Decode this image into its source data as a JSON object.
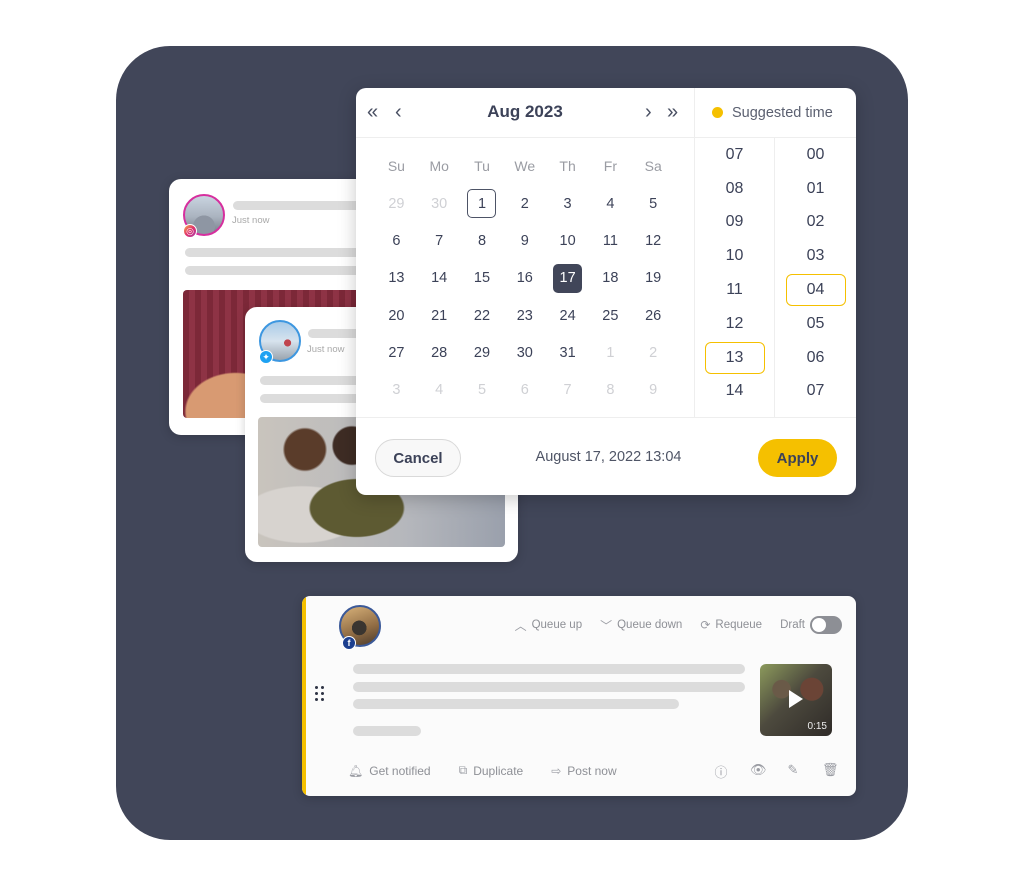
{
  "colors": {
    "backdrop": "#414659",
    "accent": "#f5c000",
    "selected_day": "#414659",
    "instagram": "#d62f9e",
    "twitter": "#1da1f2",
    "facebook": "#1c3f8f"
  },
  "posts": [
    {
      "network": "instagram",
      "timestamp": "Just now"
    },
    {
      "network": "twitter",
      "timestamp": "Just now"
    }
  ],
  "picker": {
    "nav": {
      "prev_year": "«",
      "prev_month": "‹",
      "next_month": "›",
      "next_year": "»"
    },
    "month_title": "Aug 2023",
    "suggested_label": "Suggested time",
    "weekdays": [
      "Su",
      "Mo",
      "Tu",
      "We",
      "Th",
      "Fr",
      "Sa"
    ],
    "weeks": [
      [
        {
          "d": "29",
          "m": true
        },
        {
          "d": "30",
          "m": true
        },
        {
          "d": "1",
          "today": true
        },
        {
          "d": "2"
        },
        {
          "d": "3"
        },
        {
          "d": "4"
        },
        {
          "d": "5"
        }
      ],
      [
        {
          "d": "6"
        },
        {
          "d": "7"
        },
        {
          "d": "8"
        },
        {
          "d": "9"
        },
        {
          "d": "10"
        },
        {
          "d": "11"
        },
        {
          "d": "12"
        }
      ],
      [
        {
          "d": "13"
        },
        {
          "d": "14"
        },
        {
          "d": "15"
        },
        {
          "d": "16"
        },
        {
          "d": "17",
          "selected": true
        },
        {
          "d": "18"
        },
        {
          "d": "19"
        }
      ],
      [
        {
          "d": "20"
        },
        {
          "d": "21"
        },
        {
          "d": "22"
        },
        {
          "d": "23"
        },
        {
          "d": "24"
        },
        {
          "d": "25"
        },
        {
          "d": "26"
        }
      ],
      [
        {
          "d": "27"
        },
        {
          "d": "28"
        },
        {
          "d": "29"
        },
        {
          "d": "30"
        },
        {
          "d": "31"
        },
        {
          "d": "1",
          "m": true
        },
        {
          "d": "2",
          "m": true
        }
      ],
      [
        {
          "d": "3",
          "m": true
        },
        {
          "d": "4",
          "m": true
        },
        {
          "d": "5",
          "m": true
        },
        {
          "d": "6",
          "m": true
        },
        {
          "d": "7",
          "m": true
        },
        {
          "d": "8",
          "m": true
        },
        {
          "d": "9",
          "m": true
        }
      ]
    ],
    "hours": [
      "07",
      "08",
      "09",
      "10",
      "11",
      "12",
      "13",
      "14"
    ],
    "selected_hour": "13",
    "minutes": [
      "00",
      "01",
      "02",
      "03",
      "04",
      "05",
      "06",
      "07"
    ],
    "selected_minute": "04",
    "cancel_label": "Cancel",
    "picked_value": "August 17, 2022 13:04",
    "apply_label": "Apply"
  },
  "queue_card": {
    "network": "facebook",
    "actions": {
      "queue_up": "Queue up",
      "queue_down": "Queue down",
      "requeue": "Requeue",
      "draft": "Draft"
    },
    "draft_enabled": false,
    "video_duration": "0:15",
    "footer": {
      "get_notified": "Get notified",
      "duplicate": "Duplicate",
      "post_now": "Post now"
    }
  }
}
